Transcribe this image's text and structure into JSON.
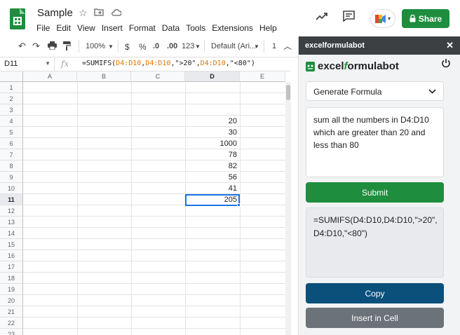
{
  "app": {
    "doc_title": "Sample",
    "menu": [
      "File",
      "Edit",
      "View",
      "Insert",
      "Format",
      "Data",
      "Tools",
      "Extensions",
      "Help"
    ],
    "share_label": "Share"
  },
  "toolbar": {
    "zoom": "100%",
    "currency": "$",
    "percent": "%",
    "dec_less": ".0",
    "dec_more": ".00",
    "number_format": "123",
    "font": "Default (Ari...",
    "font_size": "1"
  },
  "formula_bar": {
    "name_box": "D11",
    "fx": "fx",
    "prefix": "=SUMIFS(",
    "r1": "D4:D10",
    "c1": ",",
    "r2": "D4:D10",
    "c2": ",\">20\",",
    "r3": "D4:D10",
    "c3": ",\"<80\")"
  },
  "grid": {
    "columns": [
      "A",
      "B",
      "C",
      "D",
      "E"
    ],
    "rows": [
      "1",
      "2",
      "3",
      "4",
      "5",
      "6",
      "7",
      "8",
      "9",
      "10",
      "11",
      "12",
      "13",
      "14",
      "15",
      "16",
      "17",
      "18",
      "19",
      "20",
      "21",
      "22",
      "23"
    ],
    "d_values": [
      "",
      "",
      "",
      "20",
      "30",
      "1000",
      "78",
      "82",
      "56",
      "41",
      "205"
    ],
    "selected_cell": "D11"
  },
  "sidebar": {
    "header": "excelformulabot",
    "brand_pre": "excel",
    "brand_f": "f",
    "brand_post": "ormulabot",
    "mode": "Generate Formula",
    "prompt": "sum all the numbers in D4:D10 which are greater than 20 and less than 80",
    "submit_label": "Submit",
    "result": "=SUMIFS(D4:D10,D4:D10,\">20\", D4:D10,\"<80\")",
    "copy_label": "Copy",
    "insert_label": "Insert in Cell"
  },
  "colors": {
    "brand_green": "#1e8e3e",
    "copy_blue": "#0b4f7b",
    "insert_gray": "#6b7278",
    "sidebar_header": "#3c4043",
    "range_orange": "#e37400",
    "selection_blue": "#1a73e8"
  }
}
